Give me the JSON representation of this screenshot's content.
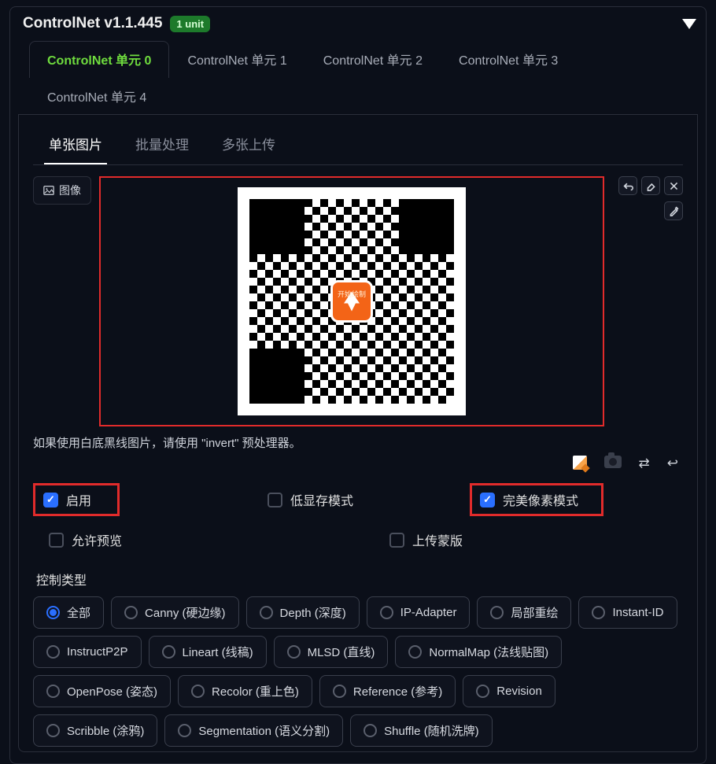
{
  "header": {
    "title": "ControlNet v1.1.445",
    "badge": "1 unit"
  },
  "tabs": [
    {
      "label": "ControlNet 单元 0",
      "active": true
    },
    {
      "label": "ControlNet 单元 1",
      "active": false
    },
    {
      "label": "ControlNet 单元 2",
      "active": false
    },
    {
      "label": "ControlNet 单元 3",
      "active": false
    },
    {
      "label": "ControlNet 单元 4",
      "active": false
    }
  ],
  "subtabs": [
    {
      "label": "单张图片",
      "active": true
    },
    {
      "label": "批量处理",
      "active": false
    },
    {
      "label": "多张上传",
      "active": false
    }
  ],
  "image_chip": "图像",
  "qr_center_text": "开始绘制",
  "hint": "如果使用白底黑线图片，请使用 \"invert\" 预处理器。",
  "checks": {
    "enable": {
      "label": "启用",
      "checked": true,
      "highlighted": true
    },
    "lowvram": {
      "label": "低显存模式",
      "checked": false,
      "highlighted": false
    },
    "pixel_perfect": {
      "label": "完美像素模式",
      "checked": true,
      "highlighted": true
    },
    "allow_preview": {
      "label": "允许预览",
      "checked": false
    },
    "upload_mask": {
      "label": "上传蒙版",
      "checked": false
    }
  },
  "ctrl_label": "控制类型",
  "ctrl_types": [
    {
      "label": "全部",
      "selected": true
    },
    {
      "label": "Canny (硬边缘)",
      "selected": false
    },
    {
      "label": "Depth (深度)",
      "selected": false
    },
    {
      "label": "IP-Adapter",
      "selected": false
    },
    {
      "label": "局部重绘",
      "selected": false
    },
    {
      "label": "Instant-ID",
      "selected": false
    },
    {
      "label": "InstructP2P",
      "selected": false
    },
    {
      "label": "Lineart (线稿)",
      "selected": false
    },
    {
      "label": "MLSD (直线)",
      "selected": false
    },
    {
      "label": "NormalMap (法线贴图)",
      "selected": false
    },
    {
      "label": "OpenPose (姿态)",
      "selected": false
    },
    {
      "label": "Recolor (重上色)",
      "selected": false
    },
    {
      "label": "Reference (参考)",
      "selected": false
    },
    {
      "label": "Revision",
      "selected": false
    },
    {
      "label": "Scribble (涂鸦)",
      "selected": false
    },
    {
      "label": "Segmentation (语义分割)",
      "selected": false
    },
    {
      "label": "Shuffle (随机洗牌)",
      "selected": false
    }
  ]
}
